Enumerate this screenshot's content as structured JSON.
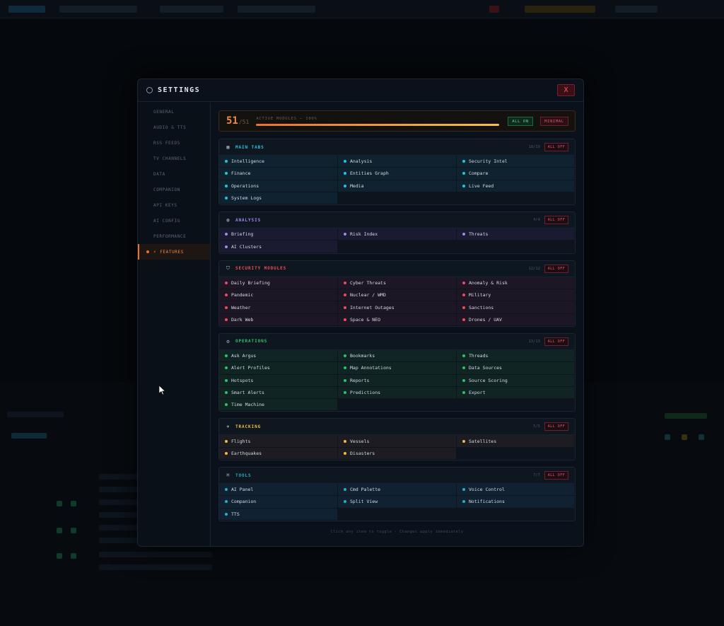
{
  "modal": {
    "title": "SETTINGS",
    "close_label": "X"
  },
  "sidebar": {
    "items": [
      {
        "label": "GENERAL"
      },
      {
        "label": "AUDIO & TTS"
      },
      {
        "label": "RSS FEEDS"
      },
      {
        "label": "TV CHANNELS"
      },
      {
        "label": "DATA"
      },
      {
        "label": "COMPANION"
      },
      {
        "label": "API KEYS"
      },
      {
        "label": "AI CONFIG"
      },
      {
        "label": "PERFORMANCE"
      },
      {
        "label": "FEATURES",
        "active": true
      }
    ]
  },
  "summary": {
    "active": "51",
    "total": "/51",
    "label": "ACTIVE MODULES — 100%",
    "percent": 100,
    "all_on_label": "ALL ON",
    "minimal_label": "MINIMAL"
  },
  "colors": {
    "accent": "#f08a3c",
    "cyan": "#22c5e8",
    "purple": "#a487f0",
    "red": "#f04a5e",
    "green": "#27c46a",
    "yellow": "#f2bd3a",
    "teal": "#1fb3c4"
  },
  "groups": [
    {
      "title": "MAIN TABS",
      "icon": "grid-icon",
      "glyph": "▦",
      "color": "#22c5e8",
      "count": "10/10",
      "off_label": "ALL OFF",
      "row_bg": "#0f2230",
      "items": [
        "Intelligence",
        "Analysis",
        "Security Intel",
        "Finance",
        "Entities Graph",
        "Compare",
        "Operations",
        "Media",
        "Live Feed",
        "System Logs"
      ]
    },
    {
      "title": "ANALYSIS",
      "icon": "chart-icon",
      "glyph": "◍",
      "color": "#a487f0",
      "count": "4/4",
      "off_label": "ALL OFF",
      "row_bg": "#1a1a30",
      "items": [
        "Briefing",
        "Risk Index",
        "Threats",
        "AI Clusters"
      ]
    },
    {
      "title": "SECURITY MODULES",
      "icon": "shield-icon",
      "glyph": "⛉",
      "color": "#f04a5e",
      "count": "12/12",
      "off_label": "ALL OFF",
      "row_bg": "#1d1624",
      "items": [
        "Daily Briefing",
        "Cyber Threats",
        "Anomaly & Risk",
        "Pandemic",
        "Nuclear / WMD",
        "Military",
        "Weather",
        "Internet Outages",
        "Sanctions",
        "Dark Web",
        "Space & NEO",
        "Drones / UAV"
      ]
    },
    {
      "title": "OPERATIONS",
      "icon": "cog-icon",
      "glyph": "⚙",
      "color": "#27c46a",
      "count": "13/13",
      "off_label": "ALL OFF",
      "row_bg": "#102424",
      "items": [
        "Ask Argus",
        "Bookmarks",
        "Threads",
        "Alert Profiles",
        "Map Annotations",
        "Data Sources",
        "Hotspots",
        "Reports",
        "Source Scoring",
        "Smart Alerts",
        "Predictions",
        "Export",
        "Time Machine"
      ]
    },
    {
      "title": "TRACKING",
      "icon": "plane-icon",
      "glyph": "✈",
      "color": "#f2bd3a",
      "count": "5/5",
      "off_label": "ALL OFF",
      "row_bg": "#1c1c22",
      "items": [
        "Flights",
        "Vessels",
        "Satellites",
        "Earthquakes",
        "Disasters"
      ]
    },
    {
      "title": "TOOLS",
      "icon": "command-icon",
      "glyph": "⌘",
      "color": "#1fb3c4",
      "count": "7/7",
      "off_label": "ALL OFF",
      "row_bg": "#102232",
      "items": [
        "AI Panel",
        "Cmd Palette",
        "Voice Control",
        "Companion",
        "Split View",
        "Notifications",
        "TTS"
      ]
    }
  ],
  "footer_hint": "Click any item to toggle · Changes apply immediately"
}
